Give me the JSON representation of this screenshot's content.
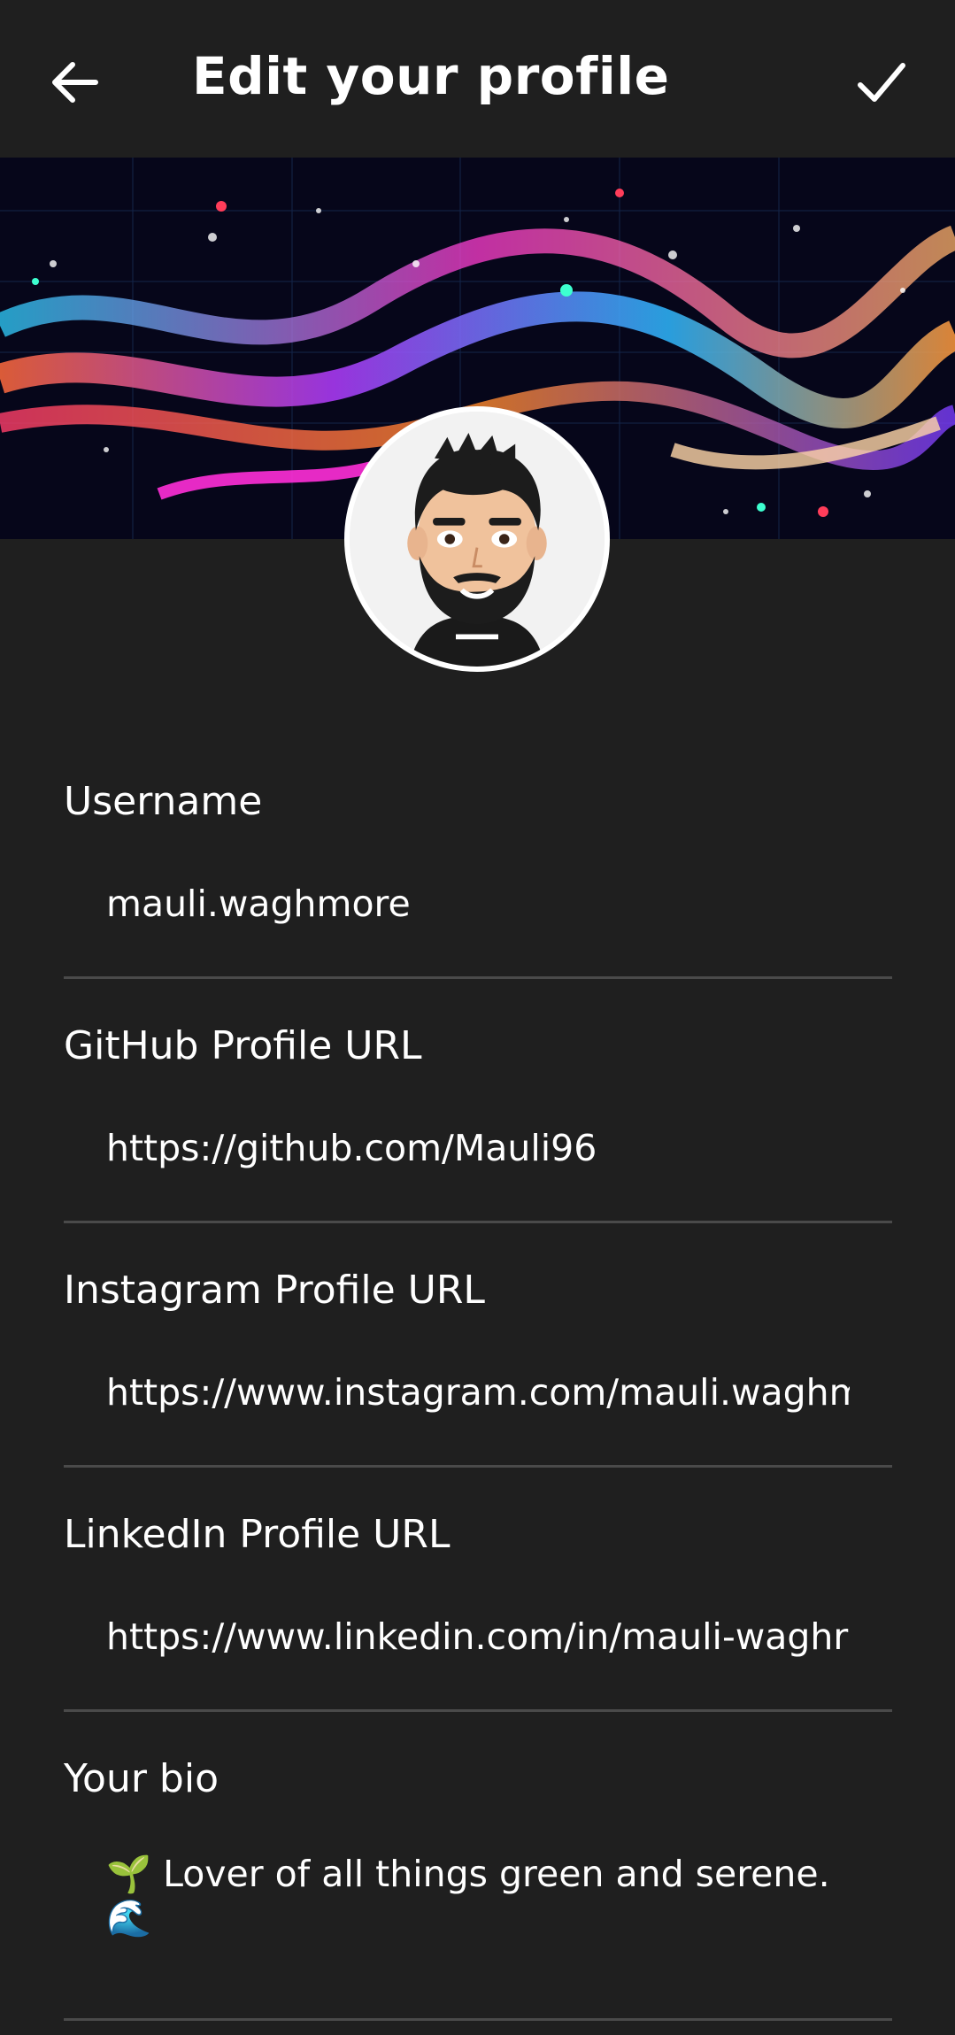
{
  "header": {
    "title": "Edit your profile",
    "back_icon": "arrow-left-icon",
    "confirm_icon": "check-icon"
  },
  "banner": {
    "description_icon": "abstract-neon-waves-image"
  },
  "avatar": {
    "icon": "bitmoji-avatar"
  },
  "fields": {
    "username": {
      "label": "Username",
      "value": "mauli.waghmore"
    },
    "github": {
      "label": "GitHub Profile URL",
      "value": "https://github.com/Mauli96"
    },
    "instagram": {
      "label": "Instagram Profile URL",
      "value": "https://www.instagram.com/mauli.waghm"
    },
    "linkedin": {
      "label": "LinkedIn Profile URL",
      "value": "https://www.linkedin.com/in/mauli-waghr"
    },
    "bio": {
      "label": "Your bio",
      "line1": "🌱 Lover of all things green and serene.",
      "line2": "🌊"
    }
  },
  "colors": {
    "background": "#1f1f1f",
    "text": "#ffffff",
    "divider": "#4a4a4a"
  }
}
